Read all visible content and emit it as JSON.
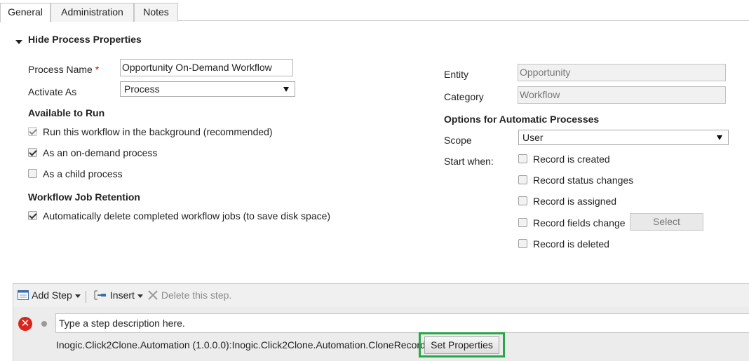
{
  "tabs": [
    {
      "label": "General",
      "active": true
    },
    {
      "label": "Administration",
      "active": false
    },
    {
      "label": "Notes",
      "active": false
    }
  ],
  "process_section": {
    "title": "Hide Process Properties",
    "process_name_label": "Process Name",
    "required_marker": "*",
    "process_name_value": "Opportunity On-Demand Workflow",
    "activate_as_label": "Activate As",
    "activate_as_value": "Process",
    "entity_label": "Entity",
    "entity_value": "Opportunity",
    "category_label": "Category",
    "category_value": "Workflow"
  },
  "available_to_run": {
    "title": "Available to Run",
    "options": [
      {
        "label": "Run this workflow in the background (recommended)",
        "checked": true,
        "disabled": true
      },
      {
        "label": "As an on-demand process",
        "checked": true,
        "disabled": false
      },
      {
        "label": "As a child process",
        "checked": false,
        "disabled": false
      }
    ]
  },
  "job_retention": {
    "title": "Workflow Job Retention",
    "options": [
      {
        "label": "Automatically delete completed workflow jobs (to save disk space)",
        "checked": true
      }
    ]
  },
  "automatic_options": {
    "title": "Options for Automatic Processes",
    "scope_label": "Scope",
    "scope_value": "User",
    "start_when_label": "Start when:",
    "triggers": [
      {
        "label": "Record is created",
        "checked": false
      },
      {
        "label": "Record status changes",
        "checked": false
      },
      {
        "label": "Record is assigned",
        "checked": false
      },
      {
        "label": "Record fields change",
        "checked": false
      },
      {
        "label": "Record is deleted",
        "checked": false
      }
    ],
    "select_button": "Select"
  },
  "step_toolbar": {
    "add_step": "Add Step",
    "insert": "Insert",
    "delete": "Delete this step."
  },
  "step": {
    "description_placeholder": "Type a step description here.",
    "assembly_text": "Inogic.Click2Clone.Automation (1.0.0.0):Inogic.Click2Clone.Automation.CloneRecords",
    "set_properties_button": "Set Properties",
    "error_icon": "error-x-icon"
  },
  "colors": {
    "highlight": "#27a844",
    "error": "#d9251d",
    "required": "#d60000"
  }
}
